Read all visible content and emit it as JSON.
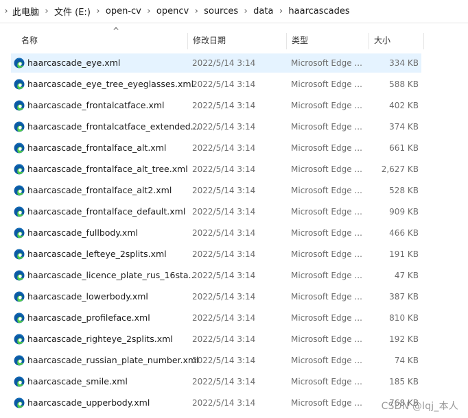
{
  "breadcrumb": [
    "此电脑",
    "文件 (E:)",
    "open-cv",
    "opencv",
    "sources",
    "data",
    "haarcascades"
  ],
  "columns": {
    "name": "名称",
    "date": "修改日期",
    "type": "类型",
    "size": "大小"
  },
  "sort_indicator": "^",
  "files": [
    {
      "name": "haarcascade_eye.xml",
      "date": "2022/5/14 3:14",
      "type": "Microsoft Edge ...",
      "size": "334 KB",
      "selected": true
    },
    {
      "name": "haarcascade_eye_tree_eyeglasses.xml",
      "date": "2022/5/14 3:14",
      "type": "Microsoft Edge ...",
      "size": "588 KB"
    },
    {
      "name": "haarcascade_frontalcatface.xml",
      "date": "2022/5/14 3:14",
      "type": "Microsoft Edge ...",
      "size": "402 KB"
    },
    {
      "name": "haarcascade_frontalcatface_extended...",
      "date": "2022/5/14 3:14",
      "type": "Microsoft Edge ...",
      "size": "374 KB"
    },
    {
      "name": "haarcascade_frontalface_alt.xml",
      "date": "2022/5/14 3:14",
      "type": "Microsoft Edge ...",
      "size": "661 KB"
    },
    {
      "name": "haarcascade_frontalface_alt_tree.xml",
      "date": "2022/5/14 3:14",
      "type": "Microsoft Edge ...",
      "size": "2,627 KB"
    },
    {
      "name": "haarcascade_frontalface_alt2.xml",
      "date": "2022/5/14 3:14",
      "type": "Microsoft Edge ...",
      "size": "528 KB"
    },
    {
      "name": "haarcascade_frontalface_default.xml",
      "date": "2022/5/14 3:14",
      "type": "Microsoft Edge ...",
      "size": "909 KB"
    },
    {
      "name": "haarcascade_fullbody.xml",
      "date": "2022/5/14 3:14",
      "type": "Microsoft Edge ...",
      "size": "466 KB"
    },
    {
      "name": "haarcascade_lefteye_2splits.xml",
      "date": "2022/5/14 3:14",
      "type": "Microsoft Edge ...",
      "size": "191 KB"
    },
    {
      "name": "haarcascade_licence_plate_rus_16sta...",
      "date": "2022/5/14 3:14",
      "type": "Microsoft Edge ...",
      "size": "47 KB"
    },
    {
      "name": "haarcascade_lowerbody.xml",
      "date": "2022/5/14 3:14",
      "type": "Microsoft Edge ...",
      "size": "387 KB"
    },
    {
      "name": "haarcascade_profileface.xml",
      "date": "2022/5/14 3:14",
      "type": "Microsoft Edge ...",
      "size": "810 KB"
    },
    {
      "name": "haarcascade_righteye_2splits.xml",
      "date": "2022/5/14 3:14",
      "type": "Microsoft Edge ...",
      "size": "192 KB"
    },
    {
      "name": "haarcascade_russian_plate_number.xml",
      "date": "2022/5/14 3:14",
      "type": "Microsoft Edge ...",
      "size": "74 KB"
    },
    {
      "name": "haarcascade_smile.xml",
      "date": "2022/5/14 3:14",
      "type": "Microsoft Edge ...",
      "size": "185 KB"
    },
    {
      "name": "haarcascade_upperbody.xml",
      "date": "2022/5/14 3:14",
      "type": "Microsoft Edge ...",
      "size": "768 KB"
    }
  ],
  "file_icon": "edge-browser-icon",
  "watermark": "CSDN @lqj_本人",
  "colors": {
    "selected_row": "#e5f3ff",
    "secondary_text": "#6d6d6d"
  }
}
